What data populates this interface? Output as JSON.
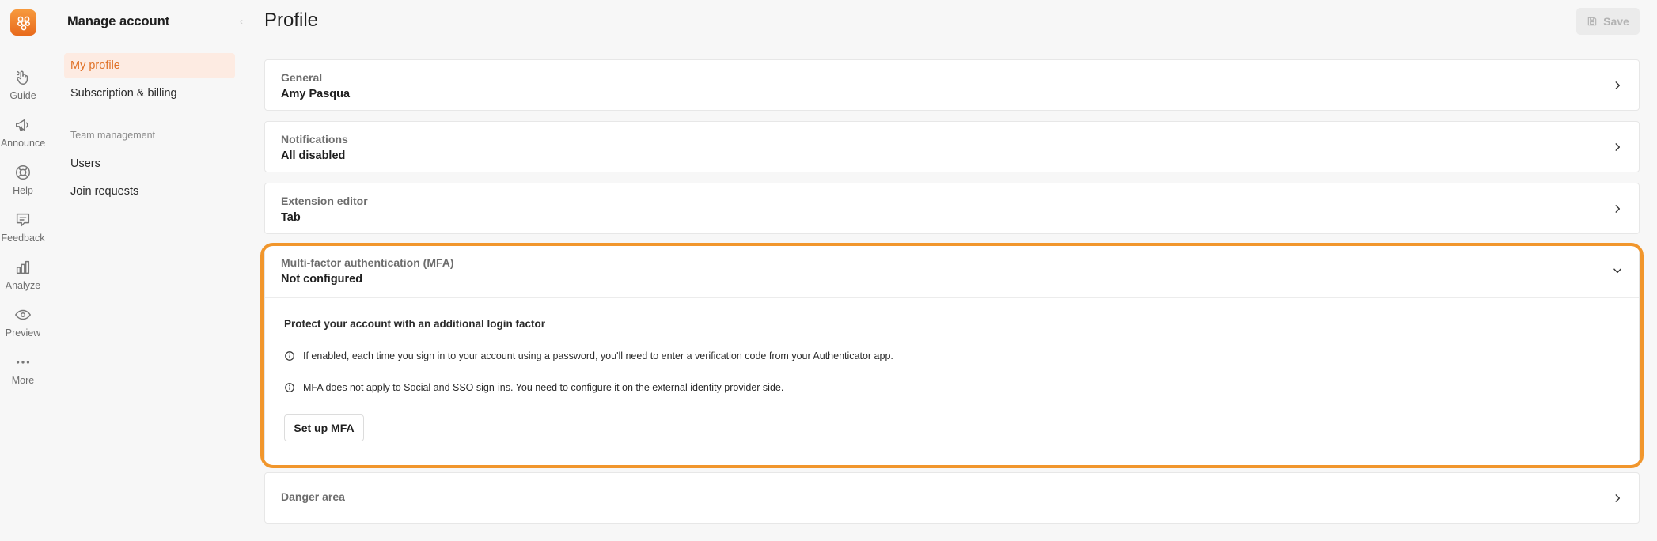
{
  "rail": {
    "items": [
      {
        "label": "Guide",
        "icon": "hand-pointer-icon"
      },
      {
        "label": "Announce",
        "icon": "megaphone-icon"
      },
      {
        "label": "Help",
        "icon": "lifebuoy-icon"
      },
      {
        "label": "Feedback",
        "icon": "feedback-icon"
      },
      {
        "label": "Analyze",
        "icon": "bar-chart-icon"
      },
      {
        "label": "Preview",
        "icon": "eye-icon"
      },
      {
        "label": "More",
        "icon": "more-dots-icon"
      }
    ]
  },
  "sidebar": {
    "title": "Manage account",
    "items": [
      {
        "label": "My profile",
        "active": true
      },
      {
        "label": "Subscription & billing",
        "active": false
      }
    ],
    "section_label": "Team management",
    "section_items": [
      {
        "label": "Users"
      },
      {
        "label": "Join requests"
      }
    ]
  },
  "header": {
    "title": "Profile",
    "save_label": "Save"
  },
  "cards": [
    {
      "label": "General",
      "value": "Amy Pasqua"
    },
    {
      "label": "Notifications",
      "value": "All disabled"
    },
    {
      "label": "Extension editor",
      "value": "Tab"
    },
    {
      "label": "Multi-factor authentication (MFA)",
      "value": "Not configured",
      "expanded": true
    },
    {
      "label": "Danger area",
      "value": ""
    }
  ],
  "mfa": {
    "heading": "Protect your account with an additional login factor",
    "info_1": "If enabled, each time you sign in to your account using a password, you'll need to enter a verification code from your Authenticator app.",
    "info_2": "MFA does not apply to Social and SSO sign-ins. You need to configure it on the external identity provider side.",
    "setup_label": "Set up MFA"
  },
  "colors": {
    "accent": "#e07228",
    "highlight": "#f1962c",
    "active_bg": "#fdebe2"
  }
}
